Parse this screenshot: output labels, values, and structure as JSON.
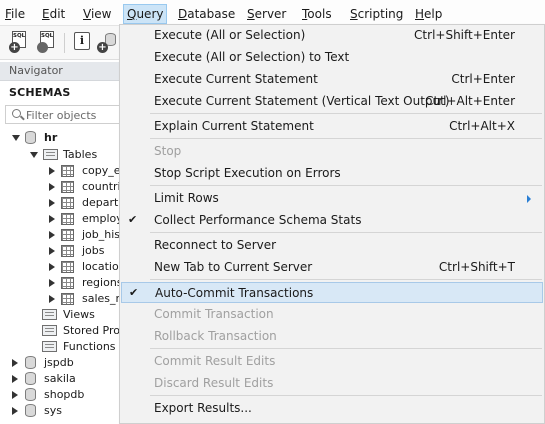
{
  "menubar": [
    {
      "label": "File",
      "key": "F",
      "rest": "ile"
    },
    {
      "label": "Edit",
      "key": "E",
      "rest": "dit"
    },
    {
      "label": "View",
      "key": "V",
      "rest": "iew"
    },
    {
      "label": "Query",
      "key": "Q",
      "rest": "uery"
    },
    {
      "label": "Database",
      "key": "D",
      "rest": "atabase"
    },
    {
      "label": "Server",
      "key": "S",
      "rest": "erver"
    },
    {
      "label": "Tools",
      "key": "T",
      "rest": "ools"
    },
    {
      "label": "Scripting",
      "key": "S",
      "rest": "cripting"
    },
    {
      "label": "Help",
      "key": "H",
      "rest": "elp"
    }
  ],
  "toolbar": {
    "doc_label": "SQL",
    "plus": "+",
    "info": "i"
  },
  "navigator": {
    "title": "Navigator",
    "schemas_label": "SCHEMAS",
    "filter_placeholder": "Filter objects",
    "tree": {
      "hr": "hr",
      "tables": "Tables",
      "table_items": [
        "copy_e",
        "countri",
        "departr",
        "employ",
        "job_his",
        "jobs",
        "locatio",
        "regions",
        "sales_r"
      ],
      "views": "Views",
      "stored_procedures": "Stored Proc",
      "functions": "Functions",
      "other_schemas": [
        "jspdb",
        "sakila",
        "shopdb",
        "sys"
      ]
    }
  },
  "query_menu": {
    "items": [
      {
        "label": "Execute (All or Selection)",
        "shortcut": "Ctrl+Shift+Enter",
        "enabled": true
      },
      {
        "label": "Execute (All or Selection) to Text",
        "shortcut": "",
        "enabled": true
      },
      {
        "label": "Execute Current Statement",
        "shortcut": "Ctrl+Enter",
        "enabled": true
      },
      {
        "label": "Execute Current Statement (Vertical Text Output)",
        "shortcut": "Ctrl+Alt+Enter",
        "enabled": true
      },
      {
        "label": "Explain Current Statement",
        "shortcut": "Ctrl+Alt+X",
        "enabled": true
      },
      {
        "label": "Stop",
        "shortcut": "",
        "enabled": false
      },
      {
        "label": "Stop Script Execution on Errors",
        "shortcut": "",
        "enabled": true
      },
      {
        "label": "Limit Rows",
        "shortcut": "",
        "enabled": true,
        "submenu": true
      },
      {
        "label": "Collect Performance Schema Stats",
        "shortcut": "",
        "enabled": true,
        "checked": true
      },
      {
        "label": "Reconnect to Server",
        "shortcut": "",
        "enabled": true
      },
      {
        "label": "New Tab to Current Server",
        "shortcut": "Ctrl+Shift+T",
        "enabled": true
      },
      {
        "label": "Auto-Commit Transactions",
        "shortcut": "",
        "enabled": true,
        "checked": true,
        "highlighted": true
      },
      {
        "label": "Commit Transaction",
        "shortcut": "",
        "enabled": false
      },
      {
        "label": "Rollback Transaction",
        "shortcut": "",
        "enabled": false
      },
      {
        "label": "Commit Result Edits",
        "shortcut": "",
        "enabled": false
      },
      {
        "label": "Discard Result Edits",
        "shortcut": "",
        "enabled": false
      },
      {
        "label": "Export Results...",
        "shortcut": "",
        "enabled": true
      }
    ],
    "check_mark": "✔"
  },
  "colors": {
    "menu_bg": "#f2f2f2",
    "highlight": "#d8e8f6",
    "active_menu": "#cce4f7",
    "disabled_text": "#a0a0a0"
  }
}
